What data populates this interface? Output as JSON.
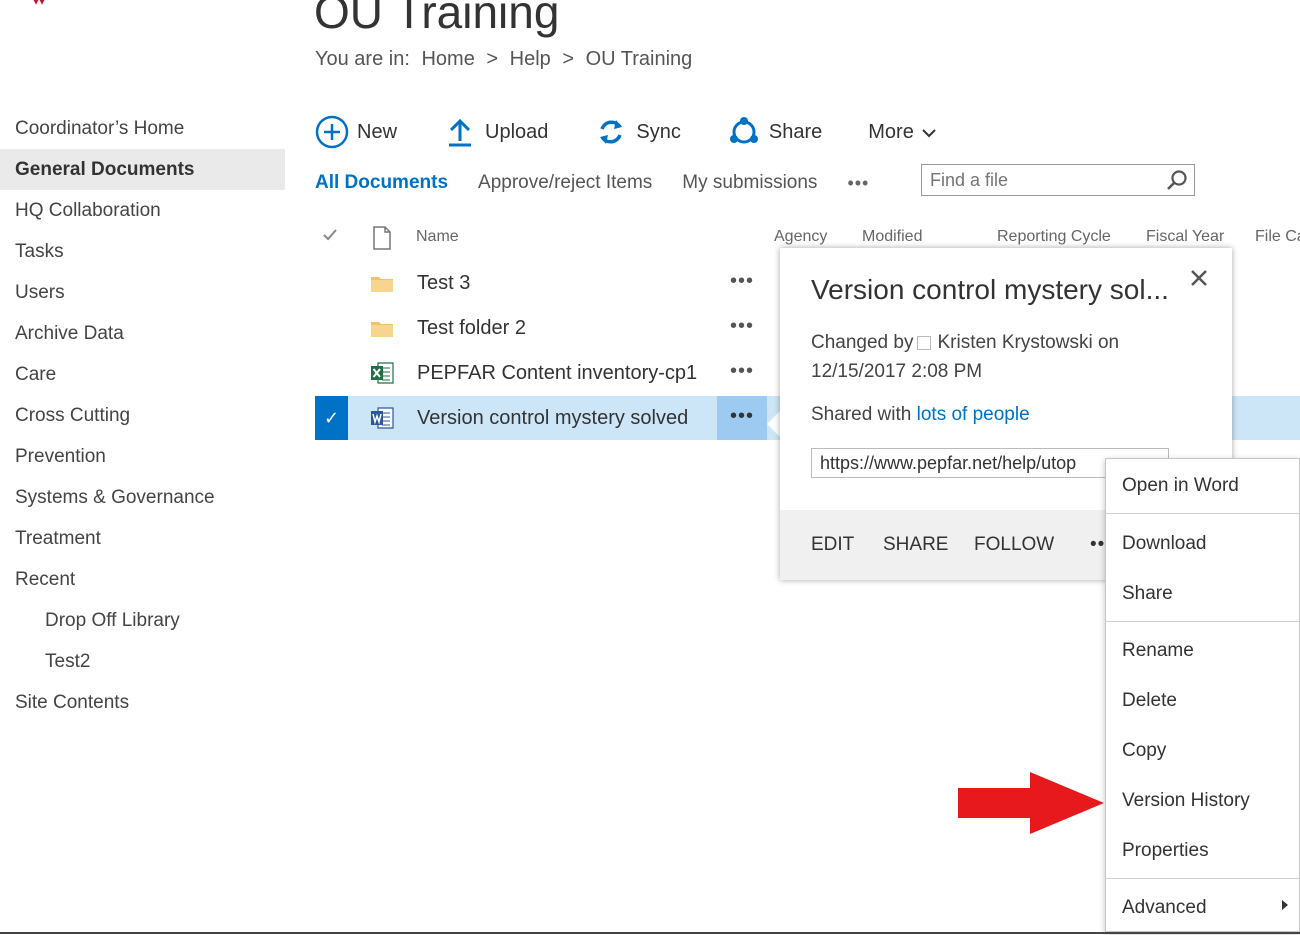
{
  "header": {
    "site_title": "OU Training",
    "breadcrumb": {
      "prefix": "You are in:",
      "items": [
        "Home",
        "Help",
        "OU Training"
      ],
      "separator": ">"
    }
  },
  "nav": {
    "items": [
      {
        "label": "Coordinator’s Home"
      },
      {
        "label": "General Documents",
        "selected": true
      },
      {
        "label": "HQ Collaboration"
      },
      {
        "label": "Tasks"
      },
      {
        "label": "Users"
      },
      {
        "label": "Archive Data"
      },
      {
        "label": "Care"
      },
      {
        "label": "Cross Cutting"
      },
      {
        "label": "Prevention"
      },
      {
        "label": "Systems & Governance"
      },
      {
        "label": "Treatment"
      },
      {
        "label": "Recent"
      },
      {
        "label": "Drop Off Library",
        "sub": true
      },
      {
        "label": "Test2",
        "sub": true
      },
      {
        "label": "Site Contents"
      }
    ]
  },
  "toolbar": {
    "new_label": "New",
    "upload_label": "Upload",
    "sync_label": "Sync",
    "share_label": "Share",
    "more_label": "More"
  },
  "views": {
    "all_documents": "All Documents",
    "approve_reject": "Approve/reject Items",
    "my_submissions": "My submissions",
    "more_dots": "•••"
  },
  "search": {
    "placeholder": "Find a file"
  },
  "columns": {
    "name": "Name",
    "agency": "Agency",
    "modified": "Modified",
    "reporting_cycle": "Reporting Cycle",
    "fiscal_year": "Fiscal Year",
    "file_category": "File Ca"
  },
  "rows": [
    {
      "name": "Test 3",
      "icon": "folder-icon"
    },
    {
      "name": "Test folder 2",
      "icon": "folder-icon"
    },
    {
      "name": "PEPFAR Content inventory-cp1",
      "icon": "excel-file-icon"
    },
    {
      "name": "Version control mystery solved",
      "icon": "word-file-icon",
      "selected": true
    }
  ],
  "ellipsis": "•••",
  "callout": {
    "title": "Version control mystery sol...",
    "changed_by_prefix": "Changed by",
    "changed_by_user": "Kristen Krystowski",
    "changed_by_on": "on",
    "changed_date": "12/15/2017 2:08 PM",
    "shared_prefix": "Shared with",
    "shared_link": "lots of people",
    "url": "https://www.pepfar.net/help/utop",
    "actions": {
      "edit": "EDIT",
      "share": "SHARE",
      "follow": "FOLLOW",
      "more": "•••"
    }
  },
  "context_menu": {
    "open_in_word": "Open in Word",
    "download": "Download",
    "share": "Share",
    "rename": "Rename",
    "delete": "Delete",
    "copy": "Copy",
    "version_history": "Version History",
    "properties": "Properties",
    "advanced": "Advanced"
  },
  "colors": {
    "accent": "#0072c6",
    "selected_row": "#cde6f7",
    "annotation_arrow": "#e8191c"
  }
}
